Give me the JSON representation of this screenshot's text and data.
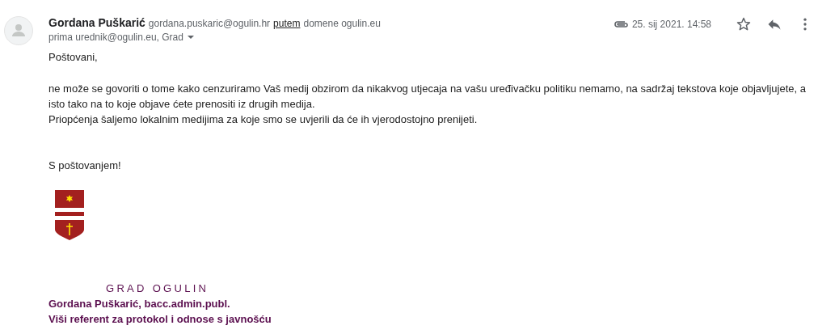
{
  "header": {
    "sender_name": "Gordana Puškarić",
    "sender_email": "gordana.puskaric@ogulin.hr",
    "via_label": "putem",
    "via_domain": "domene ogulin.eu",
    "recipients": "prima urednik@ogulin.eu, Grad",
    "date": "25. sij 2021. 14:58",
    "starred": false
  },
  "body": {
    "greeting": "Poštovani,",
    "paragraphs": [
      "ne može se govoriti o tome kako cenzuriramo Vaš medij obzirom da nikakvog utjecaja na vašu uređivačku politiku nemamo, na sadržaj tekstova koje objavljujete, a isto tako na to koje objave ćete prenositi iz drugih medija.",
      "Priopćenja šaljemo lokalnim medijima za koje smo se uvjerili da će ih vjerodostojno prenijeti."
    ],
    "closing": "S poštovanjem!"
  },
  "signature": {
    "org": "GRAD OGULIN",
    "name_line": "Gordana Puškarić, bacc.admin.publ.",
    "title_line": "Viši referent za protokol i odnose s javnošću"
  }
}
